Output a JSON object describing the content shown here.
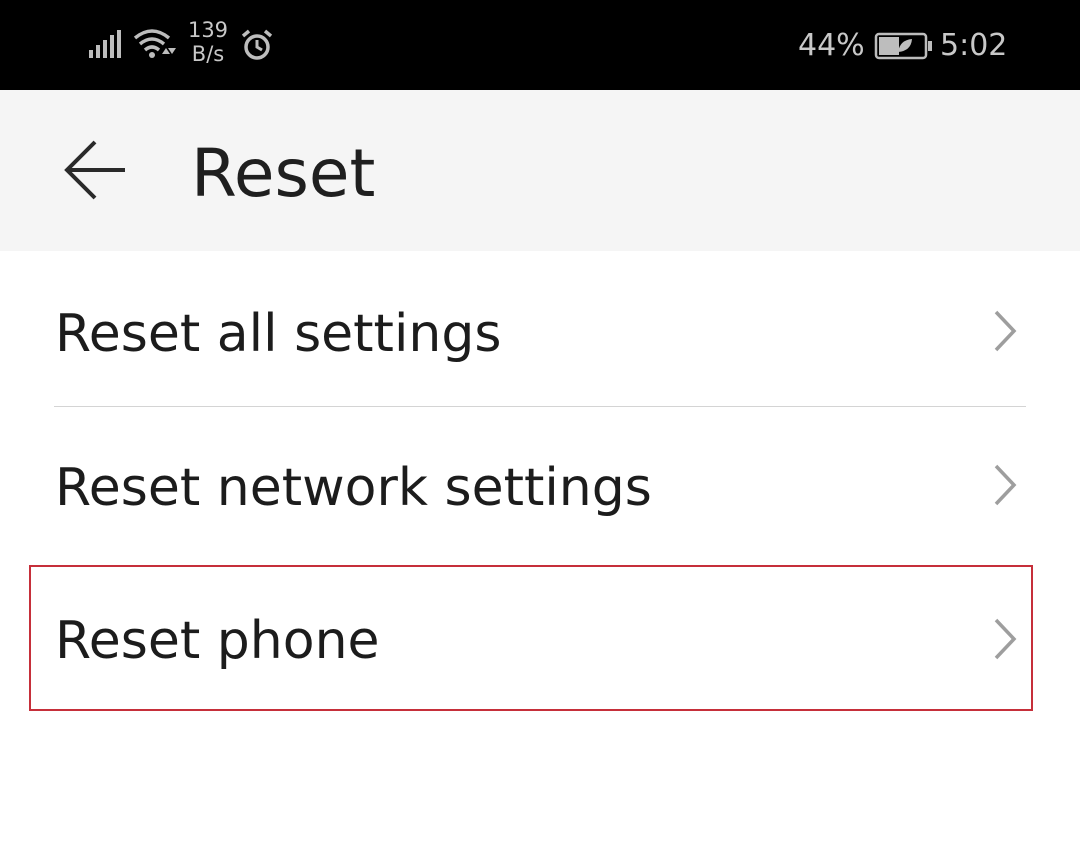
{
  "status_bar": {
    "signal_icon": "signal-bars-icon",
    "wifi_icon": "wifi-icon",
    "net_speed_value": "139",
    "net_speed_unit": "B/s",
    "alarm_icon": "alarm-clock-icon",
    "battery_percent": "44%",
    "battery_icon": "battery-saver-icon",
    "time": "5:02"
  },
  "header": {
    "back_icon": "back-arrow-icon",
    "title": "Reset"
  },
  "list": {
    "items": [
      {
        "label": "Reset all settings",
        "icon": "chevron-right-icon"
      },
      {
        "label": "Reset network settings",
        "icon": "chevron-right-icon"
      },
      {
        "label": "Reset phone",
        "icon": "chevron-right-icon",
        "highlighted": true
      }
    ]
  },
  "colors": {
    "status_bar_bg": "#000000",
    "header_bg": "#f5f5f5",
    "highlight_border": "#c62f3a",
    "chevron": "#9e9e9e"
  }
}
